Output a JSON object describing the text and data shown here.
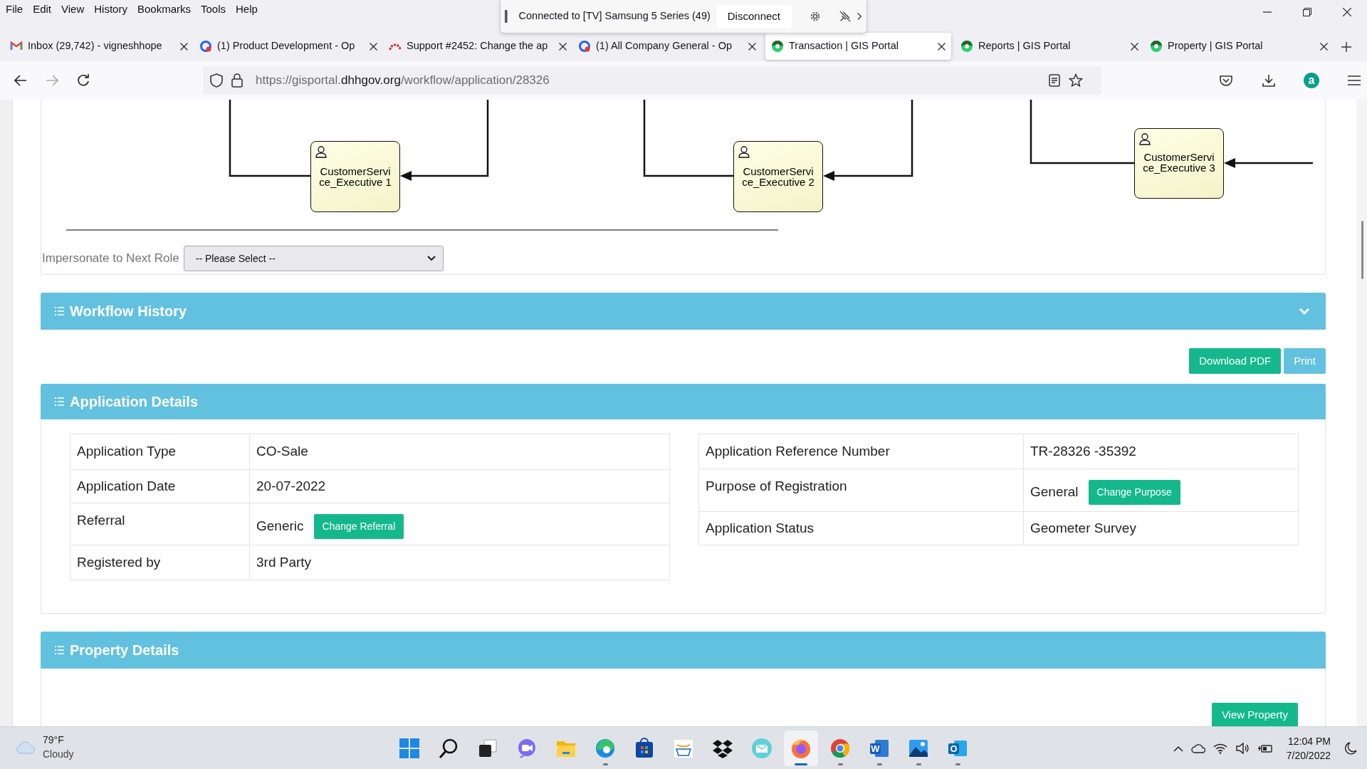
{
  "menu_bar": [
    {
      "label": "File"
    },
    {
      "label": "Edit"
    },
    {
      "label": "View"
    },
    {
      "label": "History"
    },
    {
      "label": "Bookmarks"
    },
    {
      "label": "Tools"
    },
    {
      "label": "Help"
    }
  ],
  "remote_toolbar": {
    "status": "Connected to [TV] Samsung 5 Series (49)",
    "button": "Disconnect"
  },
  "tabs": [
    {
      "kind": "gmail",
      "title": "Inbox (29,742) - vigneshhope",
      "selected": false
    },
    {
      "kind": "chat",
      "title": "(1) Product Development - Op",
      "selected": false
    },
    {
      "kind": "tracker",
      "title": "Support #2452: Change the ap",
      "selected": false
    },
    {
      "kind": "chat",
      "title": "(1) All Company General - Op",
      "selected": false
    },
    {
      "kind": "portal",
      "title": "Transaction | GIS Portal",
      "selected": true
    },
    {
      "kind": "portal",
      "title": "Reports | GIS Portal",
      "selected": false
    },
    {
      "kind": "portal",
      "title": "Property | GIS Portal",
      "selected": false
    }
  ],
  "address_bar": {
    "url_start": "https://gisportal.",
    "url_domain": "dhhgov.org",
    "url_path": "/workflow/application/28326"
  },
  "account_badge": "a",
  "workflow_diagram": {
    "nodes": [
      {
        "label": "CustomerService_Executive 1"
      },
      {
        "label": "CustomerService_Executive 2"
      },
      {
        "label": "CustomerService_Executive 3"
      }
    ]
  },
  "impersonate": {
    "label": "Impersonate to Next Role",
    "value": "-- Please Select --"
  },
  "workflow_history": {
    "title": "Workflow History"
  },
  "actions": [
    {
      "label": "Download PDF",
      "kind": "success"
    },
    {
      "label": "Print",
      "kind": "info"
    }
  ],
  "application_details": {
    "title": "Application Details",
    "left_rows": [
      {
        "label": "Application Type",
        "value": "CO-Sale"
      },
      {
        "label": "Application Date",
        "value": "20-07-2022"
      },
      {
        "label": "Referral",
        "value": "Generic",
        "button": "Change Referral"
      },
      {
        "label": "Registered by",
        "value": "3rd Party"
      }
    ],
    "right_rows": [
      {
        "label": "Application Reference Number",
        "value": "TR-28326 -35392"
      },
      {
        "label": "Purpose of Registration",
        "value": "General",
        "button": "Change Purpose"
      },
      {
        "label": "Application Status",
        "value": "Geometer Survey"
      }
    ]
  },
  "property_details": {
    "title": "Property Details",
    "button": "View Property"
  },
  "taskbar": {
    "weather": {
      "temperature": "79°F",
      "condition": "Cloudy"
    },
    "apps": [
      {
        "kind": "start",
        "running": false,
        "active": false
      },
      {
        "kind": "search",
        "running": false,
        "active": false
      },
      {
        "kind": "taskview",
        "running": false,
        "active": false
      },
      {
        "kind": "meet",
        "running": false,
        "active": false
      },
      {
        "kind": "folder",
        "running": false,
        "active": false
      },
      {
        "kind": "edge",
        "running": true,
        "active": false
      },
      {
        "kind": "store",
        "running": false,
        "active": false
      },
      {
        "kind": "shop",
        "running": false,
        "active": false
      },
      {
        "kind": "dropbox",
        "running": false,
        "active": false
      },
      {
        "kind": "mail",
        "running": false,
        "active": false
      },
      {
        "kind": "firefox",
        "running": true,
        "active": true
      },
      {
        "kind": "chrome",
        "running": true,
        "active": false
      },
      {
        "kind": "word",
        "running": true,
        "active": false,
        "glyph": "W"
      },
      {
        "kind": "photos",
        "running": true,
        "active": false
      },
      {
        "kind": "outlook",
        "running": true,
        "active": false,
        "glyph": "O"
      }
    ],
    "clock": {
      "time": "12:04 PM",
      "date": "7/20/2022"
    }
  }
}
